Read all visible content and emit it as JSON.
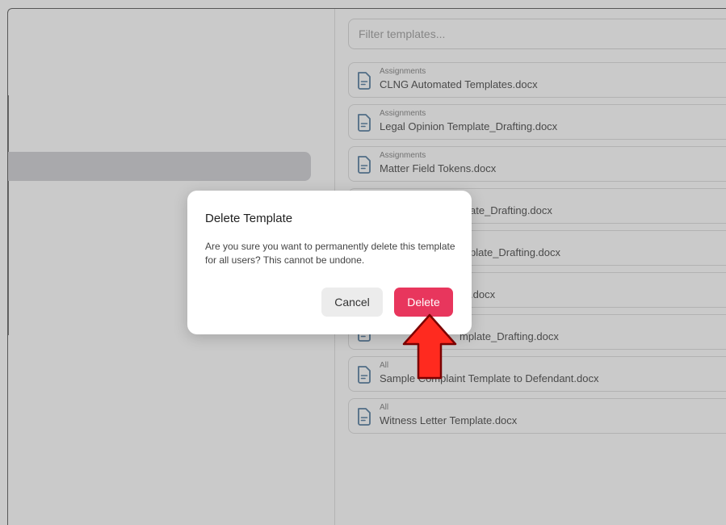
{
  "filter": {
    "placeholder": "Filter templates..."
  },
  "templates": [
    {
      "category": "Assignments",
      "name": "CLNG Automated Templates.docx"
    },
    {
      "category": "Assignments",
      "name": "Legal Opinion Template_Drafting.docx"
    },
    {
      "category": "Assignments",
      "name": "Matter Field Tokens.docx"
    },
    {
      "category": "",
      "name": "ate_Drafting.docx"
    },
    {
      "category": "",
      "name": "plate_Drafting.docx"
    },
    {
      "category": "",
      "name": ".docx"
    },
    {
      "category": "",
      "name": "mplate_Drafting.docx"
    },
    {
      "category": "All",
      "name": "Sample Complaint Template to Defendant.docx"
    },
    {
      "category": "All",
      "name": "Witness Letter Template.docx"
    }
  ],
  "dialog": {
    "title": "Delete Template",
    "message": "Are you sure you want to permanently delete this template for all users? This cannot be undone.",
    "cancel_label": "Cancel",
    "delete_label": "Delete"
  },
  "colors": {
    "accent": "#e8365d",
    "arrow": "#ff2a1f",
    "icon": "#2e5f8a"
  },
  "icons": {
    "template": "document-icon",
    "pointer": "up-arrow-icon"
  }
}
